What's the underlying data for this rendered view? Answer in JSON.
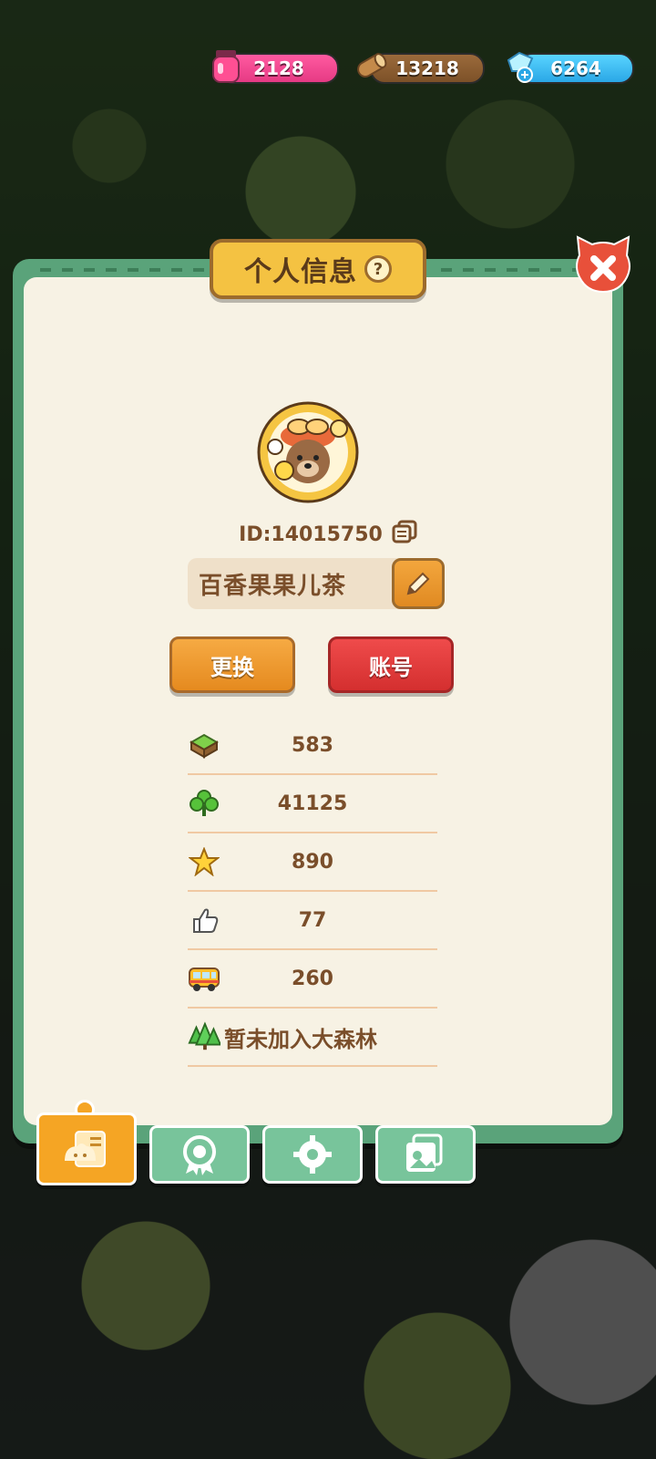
{
  "resources": {
    "jam": "2128",
    "wood": "13218",
    "gem": "6264"
  },
  "panel": {
    "title": "个人信息",
    "help_symbol": "?"
  },
  "profile": {
    "id_label": "ID:14015750",
    "name": "百香果果儿茶"
  },
  "buttons": {
    "change": "更换",
    "account": "账号"
  },
  "stats": [
    {
      "icon": "grass-block-icon",
      "value": "583"
    },
    {
      "icon": "clover-icon",
      "value": "41125"
    },
    {
      "icon": "star-icon",
      "value": "890"
    },
    {
      "icon": "thumbs-up-icon",
      "value": "77"
    },
    {
      "icon": "bus-icon",
      "value": "260"
    },
    {
      "icon": "forest-icon",
      "value": "暂未加入大森林"
    }
  ],
  "tabs": [
    {
      "name": "profile-tab",
      "active": true
    },
    {
      "name": "badge-tab",
      "active": false
    },
    {
      "name": "settings-tab",
      "active": false
    },
    {
      "name": "album-tab",
      "active": false
    }
  ],
  "colors": {
    "panel_border": "#5aa37a",
    "panel_bg": "#f7f2e4",
    "title_plate": "#f4c242",
    "text_brown": "#7a4e2a",
    "change_button": "#f6aa43",
    "account_button": "#ef4b4b",
    "close_button": "#e8503a",
    "active_tab": "#f5a524",
    "inactive_tab": "#78c49b"
  }
}
